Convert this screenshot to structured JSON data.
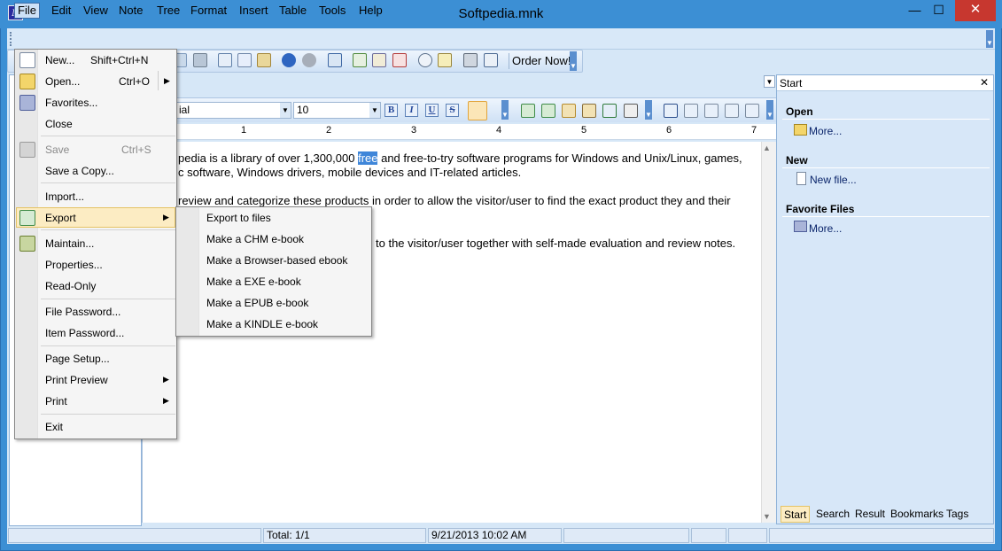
{
  "window": {
    "title": "Softpedia.mnk",
    "app_icon_letter": "N",
    "minimize": "—",
    "maximize": "☐",
    "close": "✕"
  },
  "menubar": [
    "File",
    "Edit",
    "View",
    "Note",
    "Tree",
    "Format",
    "Insert",
    "Table",
    "Tools",
    "Help"
  ],
  "toolbar": {
    "order_now": "Order Now!"
  },
  "format": {
    "font": "Arial",
    "font_visible": "ial",
    "size": "10",
    "bold": "B",
    "italic": "I",
    "underline": "U",
    "strike": "S"
  },
  "ruler": [
    "1",
    "2",
    "3",
    "4",
    "5",
    "6",
    "7"
  ],
  "editor": {
    "line1_a": "pedia is a library of over 1,300,000 ",
    "line1_hl": "free",
    "line1_b": " and free-to-try software programs for Windows and Unix/Linux, games,",
    "line2": "c software, Windows drivers, mobile devices and IT-related articles.",
    "line3": "review and categorize these products in order to allow the visitor/user to find the exact product they and their",
    "line4": "to the visitor/user together with self-made evaluation and review notes."
  },
  "right_panel": {
    "header": "Start",
    "close": "✕",
    "sections": [
      {
        "title": "Open",
        "link": "More..."
      },
      {
        "title": "New",
        "link": "New file..."
      },
      {
        "title": "Favorite Files",
        "link": "More..."
      }
    ],
    "tabs": [
      "Start",
      "Search",
      "Result",
      "Bookmarks",
      "Tags"
    ]
  },
  "status": {
    "total": "Total: 1/1",
    "datetime": "9/21/2013 10:02 AM"
  },
  "file_menu": {
    "items": {
      "new": "New...",
      "new_sc": "Shift+Ctrl+N",
      "open": "Open...",
      "open_sc": "Ctrl+O",
      "favorites": "Favorites...",
      "close": "Close",
      "save": "Save",
      "save_sc": "Ctrl+S",
      "save_copy": "Save a Copy...",
      "import": "Import...",
      "export": "Export",
      "maintain": "Maintain...",
      "properties": "Properties...",
      "read_only": "Read-Only",
      "file_password": "File Password...",
      "item_password": "Item Password...",
      "page_setup": "Page Setup...",
      "print_preview": "Print Preview",
      "print": "Print",
      "exit": "Exit"
    }
  },
  "export_submenu": [
    "Export to files",
    "Make a CHM e-book",
    "Make a Browser-based ebook",
    "Make a EXE e-book",
    "Make a EPUB e-book",
    "Make a KINDLE e-book"
  ],
  "colors": {
    "title_bar": "#3c8fd4",
    "highlight": "#fcecc3",
    "selection": "#3f86d9"
  }
}
